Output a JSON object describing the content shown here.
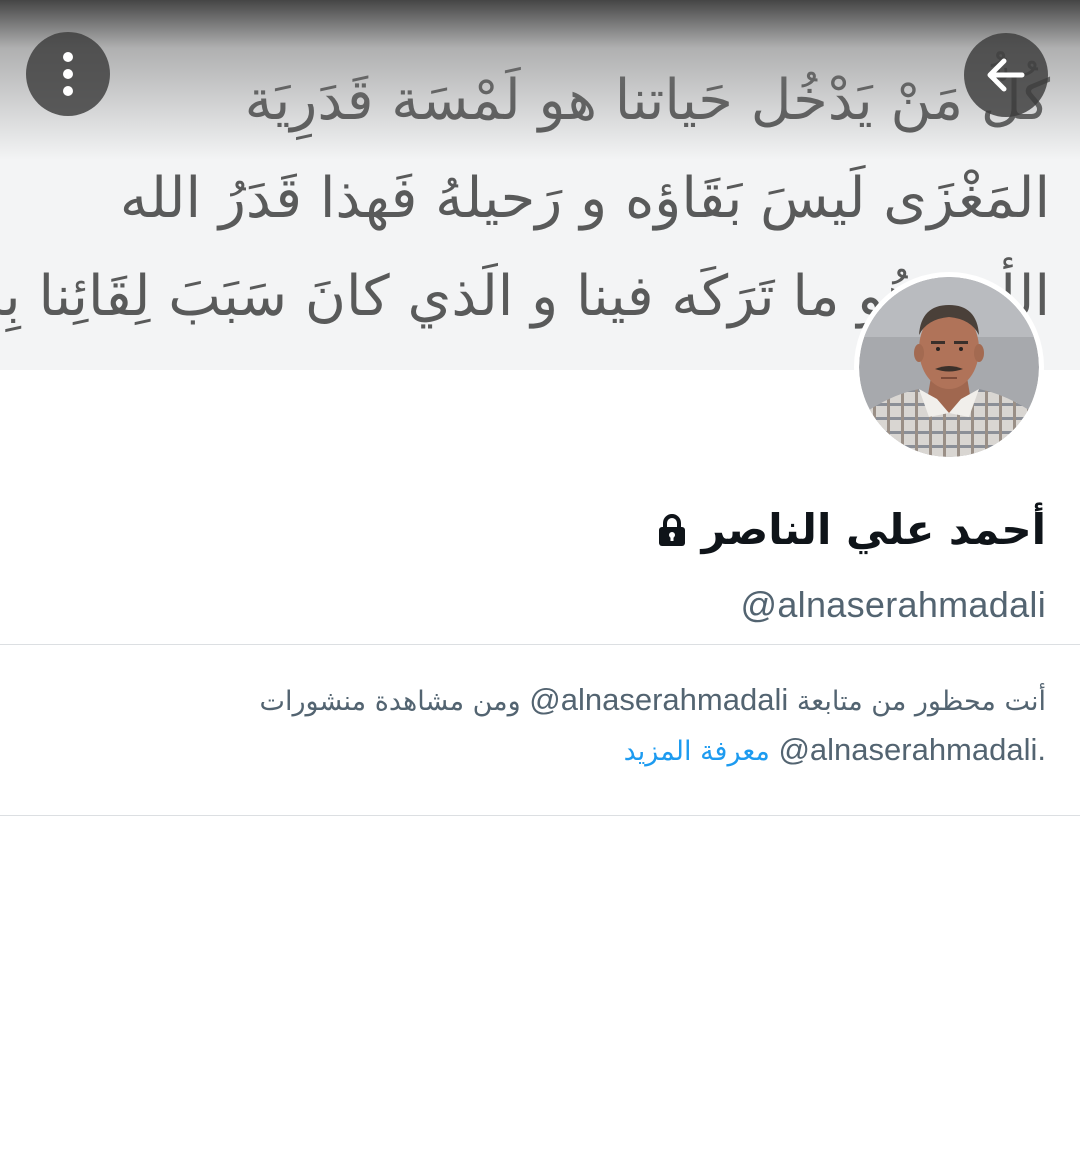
{
  "banner": {
    "lines": [
      "كُلُّ مَنْ يَدْخُل حَياتنا هو لَمْسَة قَدَرِيَة",
      "المَغْزَى لَيسَ بَقَاؤه و رَحيلهُ فَهذا قَدَرُ الله",
      "الأهم هُو ما تَرَكَه فينا و الَذي كانَ سَبَبَ لِقَائِنا بِه"
    ]
  },
  "profile": {
    "name": "أحمد علي الناصر",
    "handle": "@alnaserahmadali"
  },
  "notice": {
    "line1_prefix": "أنت محظور من متابعة",
    "handle_1": "@alnaserahmadali",
    "line1_suffix": "ومن مشاهدة منشورات",
    "handle_2": "@alnaserahmadali.",
    "learn_more": "معرفة المزيد"
  },
  "icons": {
    "menu": "more-vertical-icon",
    "back": "arrow-back-icon",
    "lock": "lock-icon"
  },
  "colors": {
    "text_primary": "#0f1419",
    "text_secondary": "#536471",
    "link": "#1d9bf0",
    "button_bg": "#3c3c3c"
  }
}
